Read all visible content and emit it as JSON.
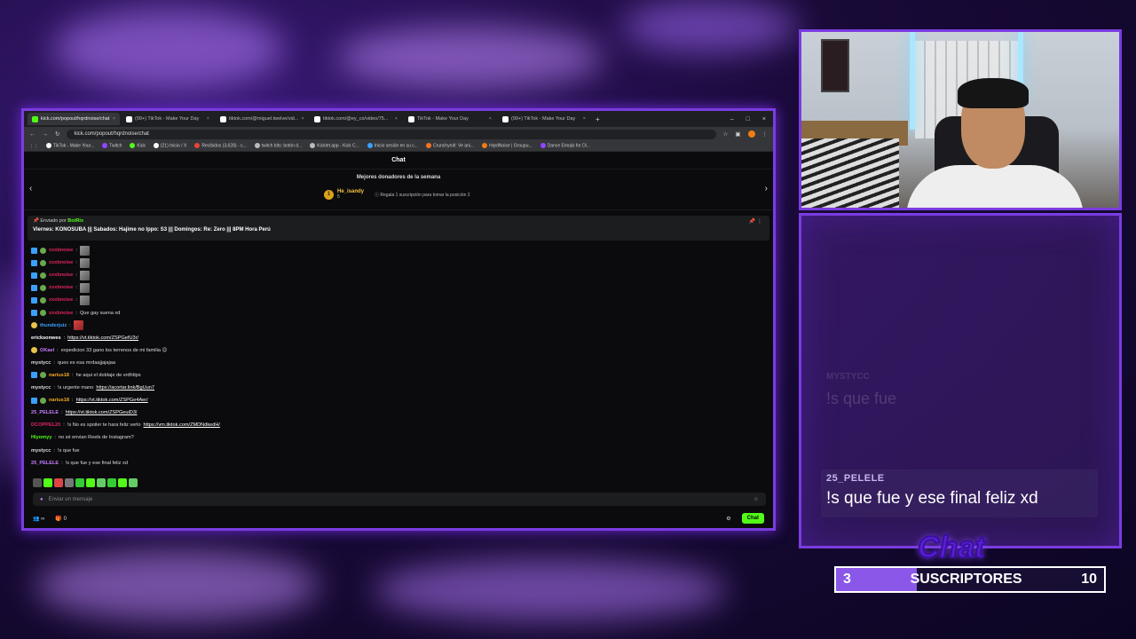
{
  "browser": {
    "tabs": [
      {
        "title": "kick.com/popout/hqrdnoise/chat",
        "color": "#53fc18"
      },
      {
        "title": "(99+) TikTok - Make Your Day",
        "color": "#ffffff"
      },
      {
        "title": "tiktok.com/@miguel.twelve/vid...",
        "color": "#ffffff"
      },
      {
        "title": "tiktok.com/@ey_co/video/75...",
        "color": "#ffffff"
      },
      {
        "title": "TikTok - Make Your Day",
        "color": "#ffffff"
      },
      {
        "title": "(99+) TikTok - Make Your Day",
        "color": "#ffffff"
      }
    ],
    "new_tab": "+",
    "window_controls": [
      "–",
      "□",
      "×"
    ],
    "url": "kick.com/popout/hqrdnoise/chat",
    "bookmarks": [
      "TikTok - Make Your...",
      "Twitch",
      "Kick",
      "(21) Inicio / X",
      "Recibidos (3,628) - c...",
      "twitch bits: botón d...",
      "Kicklet.app - Kick C...",
      "Inicio sesión en su c...",
      "Crunchyroll: Ve ani...",
      "HqrdNoise | Groupu...",
      "Dance Emojis for Di..."
    ]
  },
  "chat": {
    "title": "Chat",
    "donors": {
      "heading": "Mejores donadores de la semana",
      "top_name": "He_isandy",
      "top_amount": "5",
      "rank": "1",
      "hint": "Regala 1 suscripción para tomar la posición 2"
    },
    "pinned": {
      "sent_by": "Enviado por",
      "bot": "BotRix",
      "text": "Viernes: KONOSUBA ||| Sabados: Hajime no Ippo: S3 ||| Domingos: Re: Zero ||| 8PM Hora Perú"
    },
    "messages": [
      {
        "user": "xxxbnoise",
        "color": "#e0245e",
        "text": "",
        "badges": [
          "kick",
          "sub"
        ],
        "emote": true
      },
      {
        "user": "xxxbnoise",
        "color": "#e0245e",
        "text": "",
        "badges": [
          "kick",
          "sub"
        ],
        "emote": true
      },
      {
        "user": "xxxbnoise",
        "color": "#e0245e",
        "text": "",
        "badges": [
          "kick",
          "sub"
        ],
        "emote": true
      },
      {
        "user": "xxxbnoise",
        "color": "#e0245e",
        "text": "",
        "badges": [
          "kick",
          "sub"
        ],
        "emote": true
      },
      {
        "user": "xxxbnoise",
        "color": "#e0245e",
        "text": "",
        "badges": [
          "kick",
          "sub"
        ],
        "emote": true
      },
      {
        "user": "xxxbnoise",
        "color": "#e0245e",
        "text": "Que gay suena xd",
        "badges": [
          "kick",
          "sub"
        ],
        "emote": false
      },
      {
        "user": "thunderjuiz",
        "color": "#3aa0ff",
        "text": "",
        "badges": [
          "bulb"
        ],
        "emote": "red"
      },
      {
        "user": "ericksonwes",
        "color": "#ffffff",
        "text": "",
        "link": "https://vt.tiktok.com/ZSPGefU3r/",
        "badges": [],
        "emote": false
      },
      {
        "user": "OKael",
        "color": "#c77dff",
        "text": "expedicion 33 gano los terrenos de mi familia 😊",
        "badges": [
          "bulb"
        ],
        "emote": false
      },
      {
        "user": "mystycc",
        "color": "#dddddd",
        "text": "ques es esa mrdaajjajajaa",
        "badges": [],
        "emote": false
      },
      {
        "user": "narius18",
        "color": "#f5a623",
        "text": "he aqui el doblaje de vrdhttps",
        "badges": [
          "kick",
          "sub"
        ],
        "emote": false
      },
      {
        "user": "mystycc",
        "color": "#dddddd",
        "text": "!s urgente mano",
        "link": "https://acortar.link/BgUun7",
        "badges": [],
        "emote": false
      },
      {
        "user": "narius18",
        "color": "#f5a623",
        "text": "",
        "link": "https://vt.tiktok.com/ZSPGe4Aer/",
        "badges": [
          "kick",
          "sub"
        ],
        "emote": false
      },
      {
        "user": "25_PELELE",
        "color": "#c77dff",
        "text": "",
        "link": "https://vt.tiktok.com/ZSPGeuiD3/",
        "badges": [],
        "emote": false
      },
      {
        "user": "DCOPPEL20",
        "color": "#e0245e",
        "text": "!s No es spoiler te hara feliz verlo",
        "link": "https://vm.tiktok.com/ZMDNdkedH/",
        "badges": [],
        "emote": false
      },
      {
        "user": "Hiyomyy",
        "color": "#53fc18",
        "text": "no sé envian Reels de Instagram?",
        "badges": [],
        "emote": false
      },
      {
        "user": "mystycc",
        "color": "#dddddd",
        "text": "!s que fue",
        "badges": [],
        "emote": false
      },
      {
        "user": "25_PELELE",
        "color": "#c77dff",
        "text": "!s que fue y ese final feliz xd",
        "badges": [],
        "emote": false
      }
    ],
    "input_placeholder": "Enviar un mensaje",
    "viewers": "∞",
    "count": "0",
    "send_button": "Chat"
  },
  "overlay": {
    "ghost_user": "MYSTYCC",
    "ghost_msg": "!s que fue",
    "user": "25_PELELE",
    "message": "!s que fue y ese final feliz xd"
  },
  "sub_goal": {
    "logo": "Chat",
    "current": "3",
    "label": "SUSCRIPTORES",
    "target": "10",
    "progress": 0.3
  },
  "colors": {
    "accent": "#7a3ce0",
    "kick_green": "#53fc18"
  }
}
